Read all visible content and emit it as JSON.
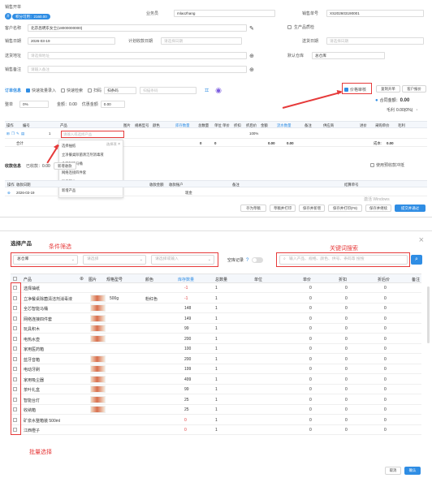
{
  "order": {
    "tab_label": "销售开单",
    "avatar_text": "开",
    "points_tag": "积分可用：2160.00",
    "salesman_label": "业务员",
    "salesman_value": "mlaozhang",
    "order_no_label": "销售单号",
    "order_no_value": "XS202603190001",
    "customer_label": "客户名称",
    "customer_value": "北京昌明东女士(18000000000)",
    "gen_label": "生产品质检",
    "date_label": "销售日期",
    "date_value": "2026-03-19",
    "plan_date_label": "计划收款日期",
    "plan_date_placeholder": "请选择日期",
    "delivery_label": "送货日期",
    "delivery_placeholder": "请选择日期",
    "ship_addr_label": "送货地址",
    "ship_addr_placeholder": "请选择地址",
    "warehouse_label": "默认仓库",
    "warehouse_value": "总仓库",
    "remark_label": "销售备注",
    "remark_placeholder": "请输入备注",
    "section_goods": "订单信息",
    "opt_fast_entry": "快速批量录入",
    "opt_fast_search": "快速检索",
    "opt_scan": "扫码",
    "scan_mode": "扫条码",
    "scan_placeholder": "扫描条码",
    "discount_label": "整单",
    "discount_value": "0%",
    "amount_label": "金额：",
    "amount_value": "0.00",
    "preferential_label": "优惠金额",
    "preferential_value": "0.00",
    "price_check": "价格审核",
    "template_btn": "复制开单",
    "customer_btn": "客户报价",
    "total_label": "合同金额：",
    "total_value": "0.00",
    "profit_label": "毛利",
    "profit_value": "0.00(0%)",
    "columns": [
      "操作",
      "编号",
      "产品",
      "图片",
      "规格型号",
      "颜色",
      "库存数量",
      "总数量",
      "单位",
      "单价",
      "折扣",
      "折后价",
      "金额",
      "流水数量",
      "备注",
      "供应商",
      "进价",
      "采购单价",
      "毛利"
    ],
    "row_no": "1",
    "product_placeholder": "请输入或选择产品",
    "discount_cell": "100%",
    "sum_label": "合计",
    "sum_qty": "0",
    "sum_qty2": "0",
    "sum_amount": "0.00",
    "sum_amount2": "0.00",
    "cost_label": "成本:",
    "cost_value": "0.00",
    "dropdown": [
      "选择抽纸",
      "立净餐桌除菌清洁剂消毒液",
      "全芯智能马桶",
      "网络连接四件套",
      "玩具积木",
      "新增产品"
    ],
    "dropdown_note": "选择项",
    "payment_section": "收款信息",
    "payment_header": "已收款：",
    "payment_amount": "0.00",
    "payment_btn": "新增收款",
    "use_prepay": "使用预收款冲抵",
    "pay_cols": [
      "操作",
      "收款日期",
      "收款金额",
      "收款账户",
      "备注",
      "结算单号"
    ],
    "pay_date": "2026-03-19",
    "pay_account": "现金",
    "watermark": "激活 Windows",
    "actions": [
      "存为草稿",
      "草稿并打印",
      "保存并新增",
      "保存并打印(F8)",
      "保存并继续",
      "提交并通过"
    ]
  },
  "dialog": {
    "title": "选择产品",
    "close": "×",
    "note_filter": "条件筛选",
    "note_keyword": "关键词搜索",
    "note_batch": "批量选择",
    "warehouse_value": "总仓库",
    "category_placeholder": "请选择",
    "attr_placeholder": "请选择或输入",
    "empty_record_label": "空库记录",
    "search_placeholder": "输入产品、规格、颜色、供号、条码等 搜搜",
    "columns": [
      "产品",
      "图片",
      "规格型号",
      "颜色",
      "库存数量",
      "总数量",
      "单位",
      "单价",
      "折扣",
      "折后价",
      "备注"
    ],
    "rows": [
      {
        "name": "选择抽纸",
        "spec": "",
        "color": "",
        "stock": "-1",
        "total": "1",
        "unit": "",
        "price": "0",
        "disc": "0",
        "after": "0",
        "img": false
      },
      {
        "name": "立净餐桌除菌清洁剂消毒液",
        "spec": "500g",
        "color": "粉红色",
        "stock": "-1",
        "total": "1",
        "unit": "",
        "price": "0",
        "disc": "0",
        "after": "0",
        "img": true
      },
      {
        "name": "全芯智能马桶",
        "spec": "",
        "color": "",
        "stock": "148",
        "total": "1",
        "unit": "",
        "price": "0",
        "disc": "0",
        "after": "0",
        "img": true
      },
      {
        "name": "网络连接四件套",
        "spec": "",
        "color": "",
        "stock": "149",
        "total": "1",
        "unit": "",
        "price": "0",
        "disc": "0",
        "after": "0",
        "img": true
      },
      {
        "name": "玩具积木",
        "spec": "",
        "color": "",
        "stock": "99",
        "total": "1",
        "unit": "",
        "price": "0",
        "disc": "0",
        "after": "0",
        "img": true
      },
      {
        "name": "电热水壶",
        "spec": "",
        "color": "",
        "stock": "200",
        "total": "1",
        "unit": "",
        "price": "0",
        "disc": "0",
        "after": "0",
        "img": true
      },
      {
        "name": "家用医药箱",
        "spec": "",
        "color": "",
        "stock": "100",
        "total": "1",
        "unit": "",
        "price": "0",
        "disc": "0",
        "after": "0",
        "img": false
      },
      {
        "name": "蓝牙音箱",
        "spec": "",
        "color": "",
        "stock": "200",
        "total": "1",
        "unit": "",
        "price": "0",
        "disc": "0",
        "after": "0",
        "img": true
      },
      {
        "name": "电动牙刷",
        "spec": "",
        "color": "",
        "stock": "199",
        "total": "1",
        "unit": "",
        "price": "0",
        "disc": "0",
        "after": "0",
        "img": true
      },
      {
        "name": "家用吸尘器",
        "spec": "",
        "color": "",
        "stock": "499",
        "total": "1",
        "unit": "",
        "price": "0",
        "disc": "0",
        "after": "0",
        "img": true
      },
      {
        "name": "茶叶礼盒",
        "spec": "",
        "color": "",
        "stock": "99",
        "total": "1",
        "unit": "",
        "price": "0",
        "disc": "0",
        "after": "0",
        "img": true
      },
      {
        "name": "智能台灯",
        "spec": "",
        "color": "",
        "stock": "25",
        "total": "1",
        "unit": "",
        "price": "0",
        "disc": "0",
        "after": "0",
        "img": true
      },
      {
        "name": "收纳箱",
        "spec": "",
        "color": "",
        "stock": "25",
        "total": "1",
        "unit": "",
        "price": "0",
        "disc": "0",
        "after": "0",
        "img": true
      },
      {
        "name": "矿泉水整箱装 500ml",
        "spec": "",
        "color": "",
        "stock": "0",
        "total": "1",
        "unit": "",
        "price": "0",
        "disc": "0",
        "after": "0",
        "img": false
      },
      {
        "name": "江西橙子",
        "spec": "",
        "color": "",
        "stock": "0",
        "total": "1",
        "unit": "",
        "price": "0",
        "disc": "0",
        "after": "0",
        "img": false
      }
    ],
    "cancel_btn": "取消",
    "confirm_btn": "确认",
    "colors": {
      "accent": "#2f8de4",
      "annotation": "#e63a3a",
      "negative": "#e03d3d"
    }
  }
}
